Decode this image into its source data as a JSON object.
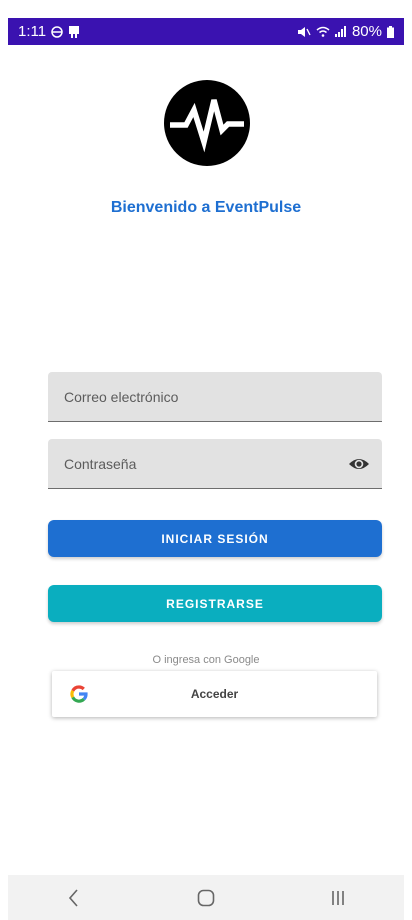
{
  "status_bar": {
    "time": "1:11",
    "battery": "80%",
    "background": "#3a12b0"
  },
  "app": {
    "logo_icon": "heartbeat-pulse-icon",
    "welcome": "Bienvenido a EventPulse",
    "accent": "#1e6fd1"
  },
  "form": {
    "email_placeholder": "Correo electrónico",
    "password_placeholder": "Contraseña",
    "email_value": "",
    "password_value": "",
    "password_toggle_icon": "eye-icon"
  },
  "buttons": {
    "login": "INICIAR SESIÓN",
    "register": "REGISTRARSE",
    "login_color": "#1e6fd1",
    "register_color": "#0aaebf"
  },
  "google": {
    "prompt": "O ingresa con Google",
    "button": "Acceder",
    "icon": "google-icon"
  },
  "nav_bar": {
    "items": [
      "back-icon",
      "home-icon",
      "recents-icon"
    ]
  }
}
